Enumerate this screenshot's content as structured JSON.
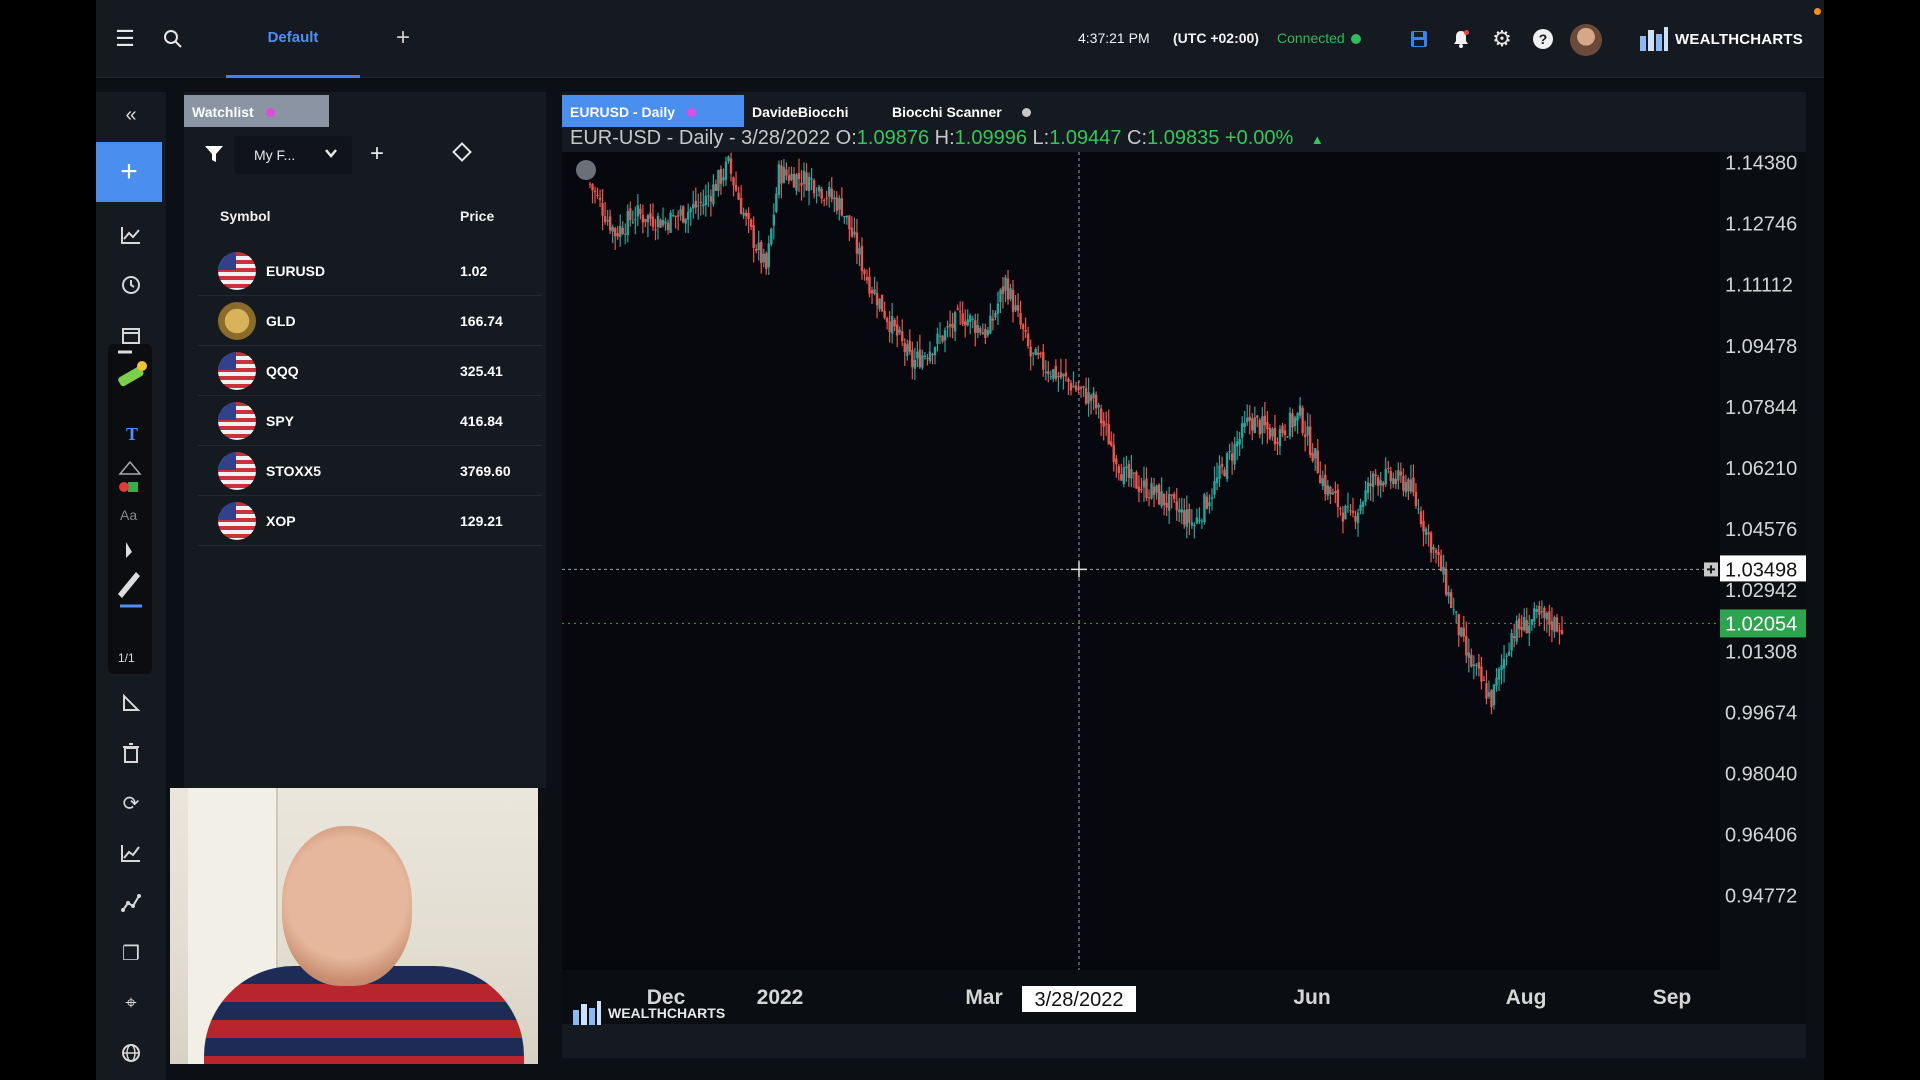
{
  "topbar": {
    "layout_tab": "Default",
    "time": "4:37:21 PM",
    "timezone": "(UTC +02:00)",
    "connection_status": "Connected",
    "brand": "WEALTHCHARTS"
  },
  "watchlist": {
    "tab_label": "Watchlist",
    "list_select": "My F...",
    "columns": {
      "symbol": "Symbol",
      "price": "Price"
    },
    "rows": [
      {
        "symbol": "EURUSD",
        "price": "1.02",
        "icon": "us-flag-icon"
      },
      {
        "symbol": "GLD",
        "price": "166.74",
        "icon": "gold-coin-icon"
      },
      {
        "symbol": "QQQ",
        "price": "325.41",
        "icon": "us-flag-icon"
      },
      {
        "symbol": "SPY",
        "price": "416.84",
        "icon": "us-flag-icon"
      },
      {
        "symbol": "STOXX5",
        "price": "3769.60",
        "icon": "us-flag-icon"
      },
      {
        "symbol": "XOP",
        "price": "129.21",
        "icon": "us-flag-icon"
      }
    ]
  },
  "chart_tabs": [
    "EURUSD - Daily",
    "DavideBiocchi",
    "Biocchi Scanner"
  ],
  "chart_header": {
    "title": "EUR-USD - Daily - 3/28/2022",
    "open_label": "O:",
    "open": "1.09876",
    "high_label": "H:",
    "high": "1.09996",
    "low_label": "L:",
    "low": "1.09447",
    "close_label": "C:",
    "close": "1.09835",
    "change": "+0.00%"
  },
  "watermark": "WEALTHCHARTS",
  "colors": {
    "accent": "#4a8ff0",
    "up": "#26a69a",
    "down": "#ef5350",
    "connected": "#2dbd5a",
    "price_tag": "#2da44e"
  },
  "chart_data": {
    "type": "candlestick",
    "symbol": "EUR-USD",
    "interval": "Daily",
    "y_ticks": [
      "1.14380",
      "1.12746",
      "1.11112",
      "1.09478",
      "1.07844",
      "1.06210",
      "1.04576",
      "1.02942",
      "1.01308",
      "0.99674",
      "0.98040",
      "0.96406",
      "0.94772"
    ],
    "ylim": [
      0.93,
      1.145
    ],
    "x_ticks": [
      "Dec",
      "2022",
      "Mar",
      "Jun",
      "Aug",
      "Sep"
    ],
    "crosshair": {
      "date_label": "3/28/2022",
      "price_label": "1.03498"
    },
    "last_price_label": "1.02054",
    "close_path": [
      {
        "t": 0,
        "v": 1.138
      },
      {
        "t": 10,
        "v": 1.125
      },
      {
        "t": 18,
        "v": 1.13
      },
      {
        "t": 30,
        "v": 1.128
      },
      {
        "t": 45,
        "v": 1.133
      },
      {
        "t": 55,
        "v": 1.143
      },
      {
        "t": 62,
        "v": 1.128
      },
      {
        "t": 70,
        "v": 1.115
      },
      {
        "t": 75,
        "v": 1.141
      },
      {
        "t": 88,
        "v": 1.139
      },
      {
        "t": 100,
        "v": 1.132
      },
      {
        "t": 110,
        "v": 1.113
      },
      {
        "t": 120,
        "v": 1.1
      },
      {
        "t": 128,
        "v": 1.09
      },
      {
        "t": 138,
        "v": 1.096
      },
      {
        "t": 148,
        "v": 1.103
      },
      {
        "t": 158,
        "v": 1.098
      },
      {
        "t": 165,
        "v": 1.112
      },
      {
        "t": 175,
        "v": 1.092
      },
      {
        "t": 190,
        "v": 1.085
      },
      {
        "t": 200,
        "v": 1.08
      },
      {
        "t": 212,
        "v": 1.06
      },
      {
        "t": 225,
        "v": 1.055
      },
      {
        "t": 240,
        "v": 1.047
      },
      {
        "t": 250,
        "v": 1.06
      },
      {
        "t": 262,
        "v": 1.075
      },
      {
        "t": 272,
        "v": 1.071
      },
      {
        "t": 282,
        "v": 1.076
      },
      {
        "t": 292,
        "v": 1.057
      },
      {
        "t": 302,
        "v": 1.048
      },
      {
        "t": 312,
        "v": 1.06
      },
      {
        "t": 325,
        "v": 1.058
      },
      {
        "t": 338,
        "v": 1.035
      },
      {
        "t": 348,
        "v": 1.012
      },
      {
        "t": 358,
        "v": 1.0
      },
      {
        "t": 366,
        "v": 1.018
      },
      {
        "t": 376,
        "v": 1.022
      },
      {
        "t": 386,
        "v": 1.02
      }
    ]
  }
}
